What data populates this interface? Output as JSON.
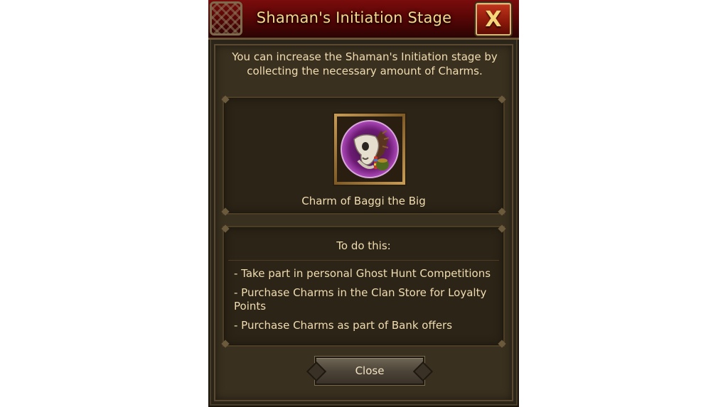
{
  "dialog": {
    "title": "Shaman's Initiation Stage",
    "close_x": "X",
    "intro": "You can increase the Shaman's Initiation stage by collecting the necessary amount of Charms.",
    "charm": {
      "name": "Charm of Baggi the Big",
      "icon": "charm-skull-icon"
    },
    "todo": {
      "heading": "To do this:",
      "items": [
        "- Take part in personal Ghost Hunt Competitions",
        "- Purchase Charms in the Clan Store for Loyalty Points",
        "- Purchase Charms as part of Bank offers"
      ]
    },
    "close_button": "Close"
  },
  "colors": {
    "title_text": "#f5d98e",
    "body_text": "#f1ddb2",
    "titlebar_red": "#7a0c0c",
    "panel_bg": "#2c2416"
  }
}
